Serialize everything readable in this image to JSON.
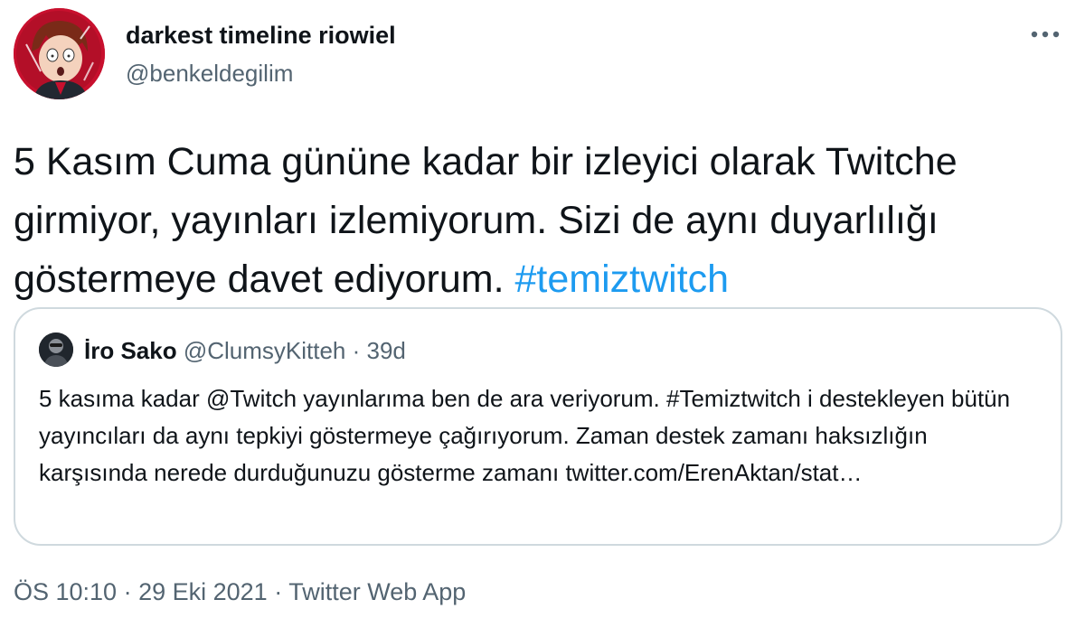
{
  "author": {
    "display_name": "darkest timeline riowiel",
    "handle": "@benkeldegilim",
    "avatar_icon": "cartoon-avatar"
  },
  "more_icon": "more-options-icon",
  "tweet": {
    "text": "5 Kasım Cuma gününe kadar bir izleyici olarak Twitche girmiyor, yayınları izlemiyorum. Sizi de aynı duyarlılığı göstermeye davet ediyorum. ",
    "hashtag": "#temiztwitch"
  },
  "quoted_tweet": {
    "name": "İro Sako",
    "handle": "@ClumsyKitteh",
    "separator": " · ",
    "time": "39d",
    "text": "5 kasıma kadar @Twitch yayınlarıma ben de ara veriyorum. #Temiztwitch i destekleyen bütün yayıncıları da aynı tepkiyi göstermeye çağırıyorum. Zaman destek zamanı haksızlığın karşısında nerede durduğunuzu gösterme zamanı twitter.com/ErenAktan/stat…"
  },
  "footer": {
    "time": "ÖS 10:10",
    "sep1": " · ",
    "date": "29 Eki 2021",
    "sep2": " · ",
    "source": "Twitter Web App"
  },
  "colors": {
    "accent": "#1d9bf0",
    "muted": "#536471",
    "border": "#cfd9de",
    "text": "#0f1419"
  }
}
